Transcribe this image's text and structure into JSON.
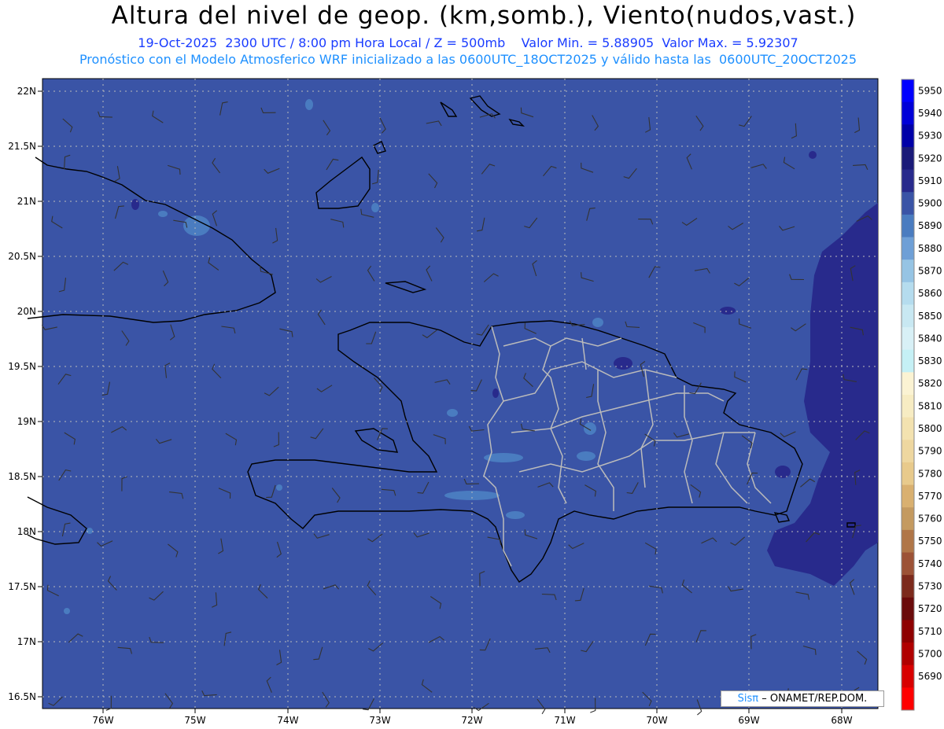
{
  "header": {
    "title": "Altura del nivel de geop. (km,somb.), Viento(nudos,vast.)",
    "line1": "19-Oct-2025  2300 UTC / 8:00 pm Hora Local / Z = 500mb    Valor Min. = 5.88905  Valor Max. = 5.92307",
    "line2": "Pronóstico con el Modelo Atmosferico WRF inicializado a las 0600UTC_18OCT2025 y válido hasta las  0600UTC_20OCT2025"
  },
  "axes": {
    "lat_labels": [
      "22N",
      "21.5N",
      "21N",
      "20.5N",
      "20N",
      "19.5N",
      "19N",
      "18.5N",
      "18N",
      "17.5N",
      "17N",
      "16.5N"
    ],
    "lon_labels": [
      "76W",
      "75W",
      "74W",
      "73W",
      "72W",
      "71W",
      "70W",
      "69W",
      "68W"
    ]
  },
  "colorbar": {
    "levels": [
      "5950",
      "5940",
      "5930",
      "5920",
      "5910",
      "5900",
      "5890",
      "5880",
      "5870",
      "5860",
      "5850",
      "5840",
      "5830",
      "5820",
      "5810",
      "5800",
      "5790",
      "5780",
      "5770",
      "5760",
      "5750",
      "5740",
      "5730",
      "5720",
      "5710",
      "5700",
      "5690"
    ],
    "colors": [
      "#0000ff",
      "#0000d8",
      "#0000a8",
      "#1a1a78",
      "#282a8c",
      "#3a54a6",
      "#4a7cc0",
      "#6e9fd6",
      "#96c4e4",
      "#b5dcee",
      "#c8e8f2",
      "#d8f0f6",
      "#c5f0f5",
      "#fbf3d3",
      "#f7ecc3",
      "#f3e2b0",
      "#eed7a0",
      "#e8ca8c",
      "#d9b070",
      "#c49a60",
      "#b07648",
      "#9c5236",
      "#7c2a1c",
      "#6a0a0a",
      "#8e0000",
      "#b00000",
      "#d80000",
      "#ff0000"
    ]
  },
  "credit": {
    "brand": "Sisπ",
    "text": "– ONAMET/REP.DOM."
  }
}
